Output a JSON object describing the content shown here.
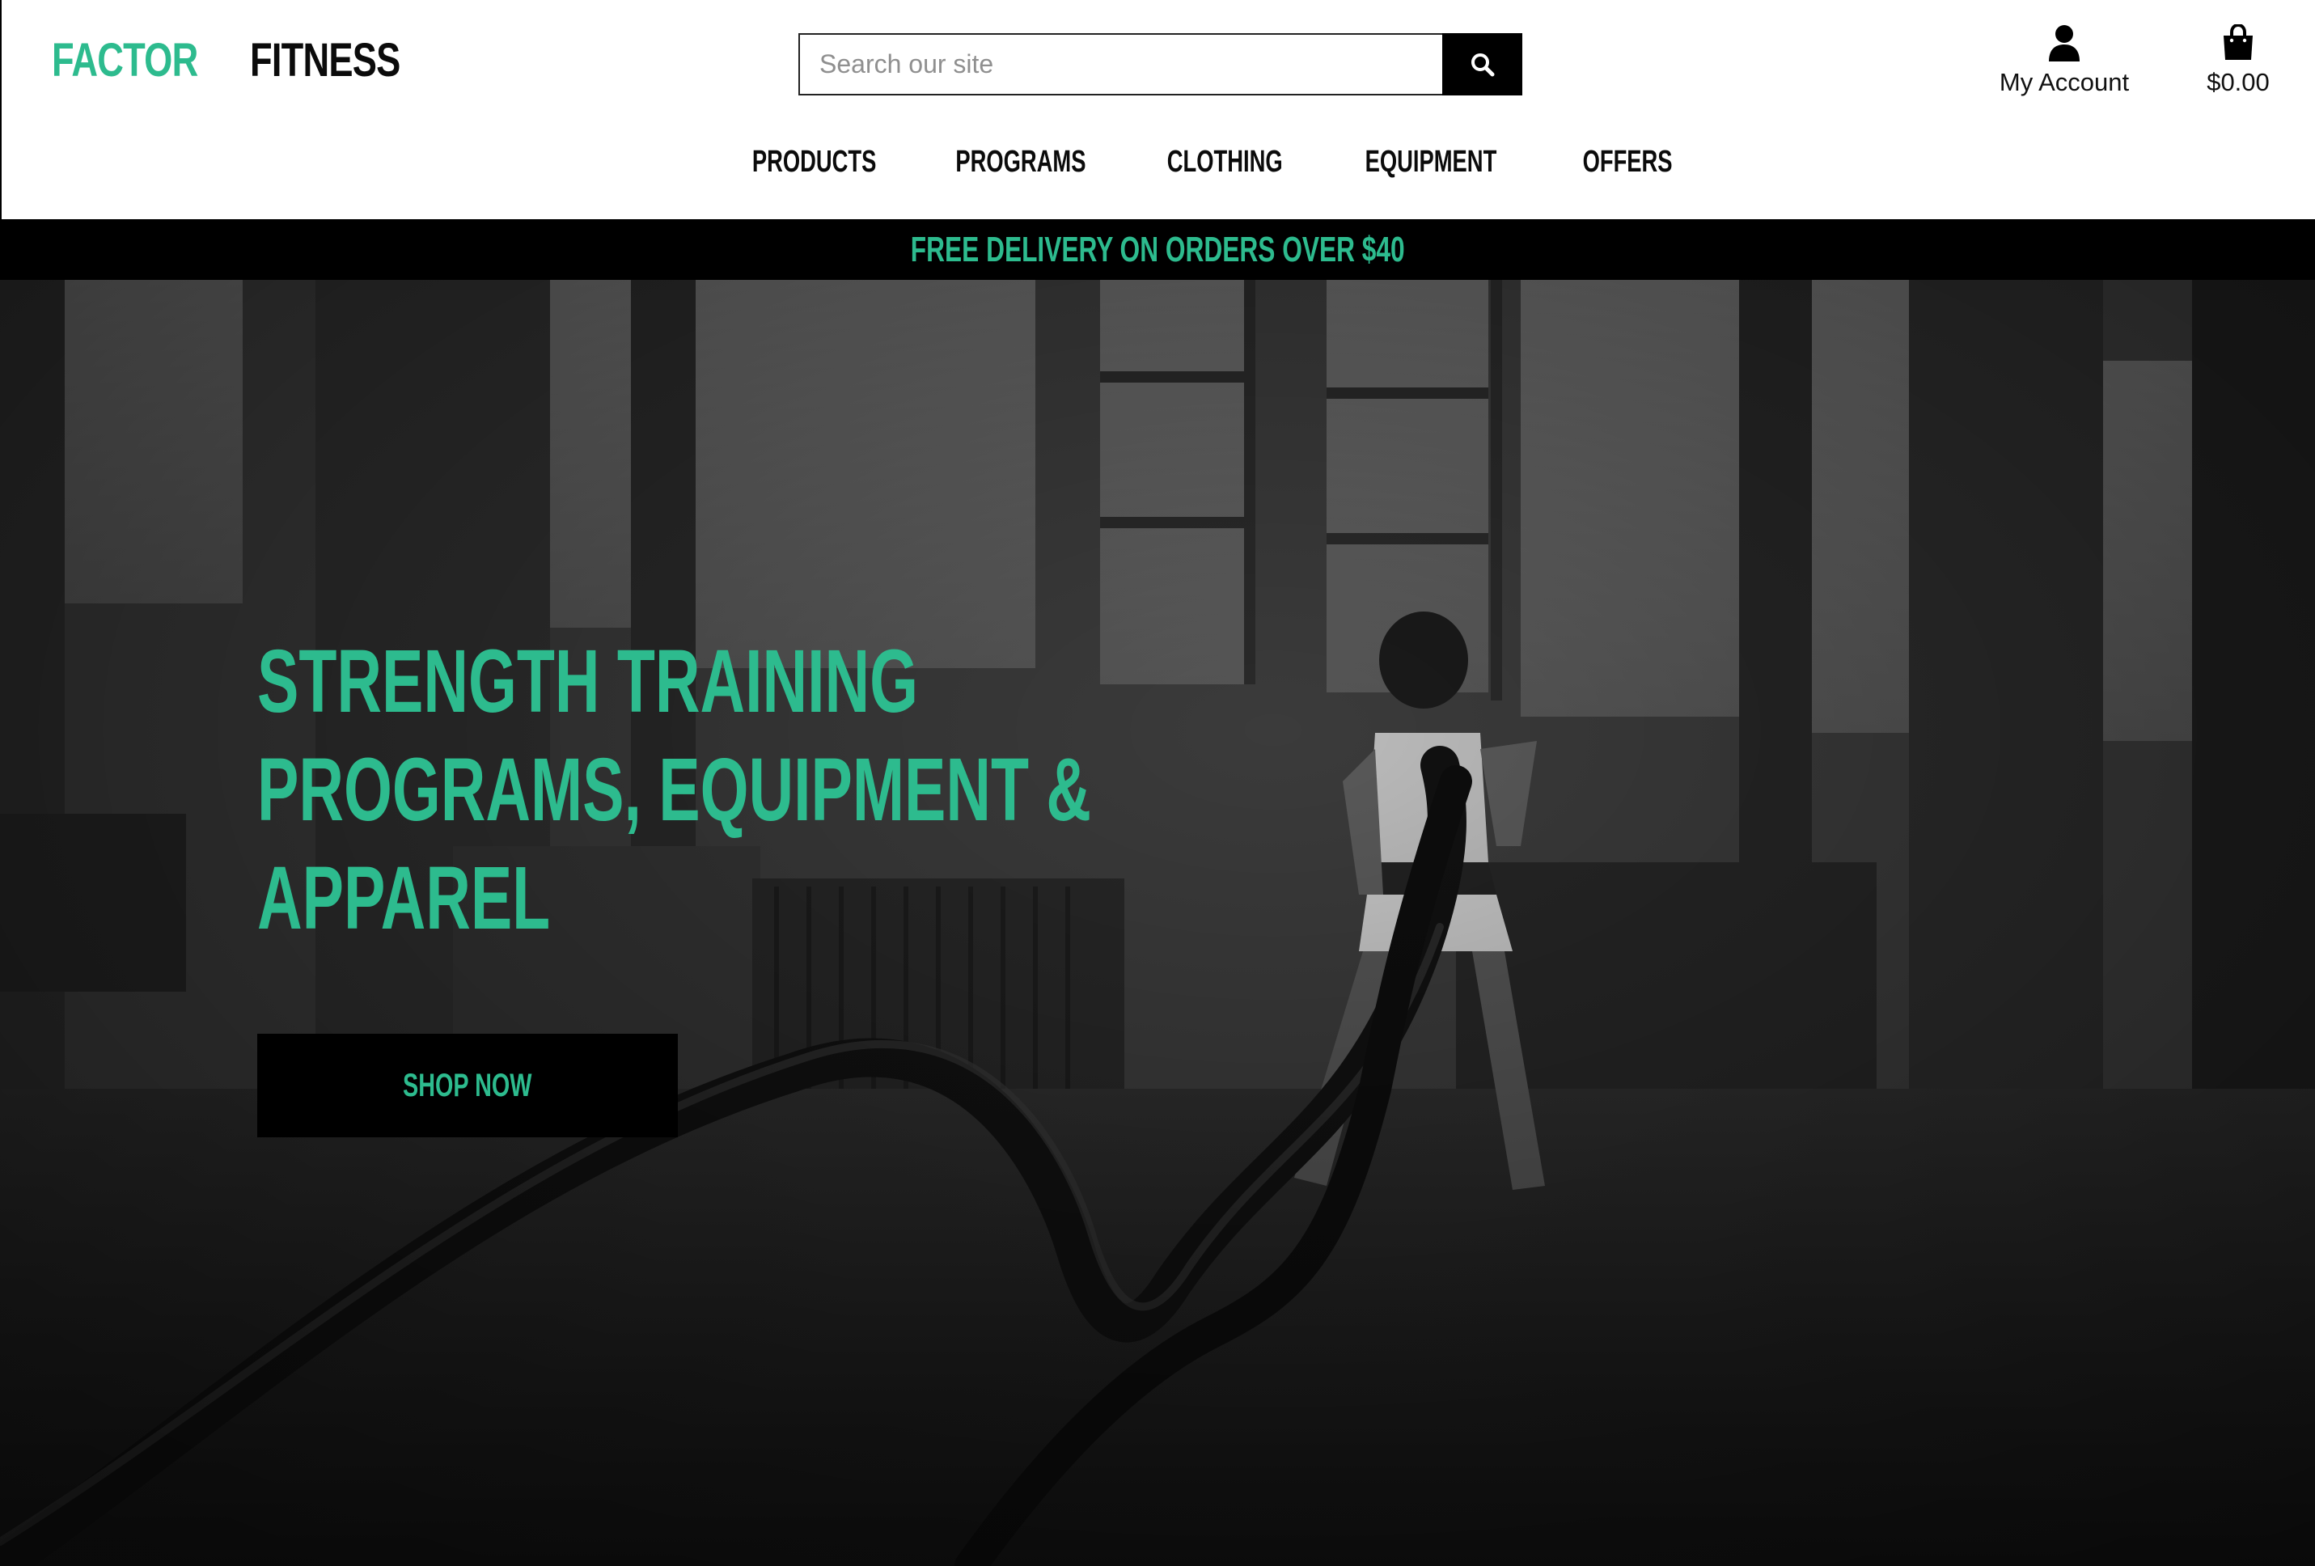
{
  "brand": {
    "name_part1": "FACTOR",
    "name_part2": "FITNESS",
    "accent_color": "#2dbb8e"
  },
  "search": {
    "placeholder": "Search our site",
    "value": "",
    "button_icon": "search-icon"
  },
  "account": {
    "icon": "user-icon",
    "label": "My Account"
  },
  "cart": {
    "icon": "shopping-bag-icon",
    "total": "$0.00"
  },
  "nav": {
    "items": [
      {
        "label": "PRODUCTS"
      },
      {
        "label": "PROGRAMS"
      },
      {
        "label": "CLOTHING"
      },
      {
        "label": "EQUIPMENT"
      },
      {
        "label": "OFFERS"
      }
    ]
  },
  "promo": {
    "text": "FREE DELIVERY ON ORDERS OVER $40"
  },
  "hero": {
    "headline_lines": [
      "STRENGTH TRAINING",
      "PROGRAMS, EQUIPMENT &",
      "APPAREL"
    ],
    "cta_label": "SHOP NOW",
    "image_description_icon": "hero-photo"
  }
}
